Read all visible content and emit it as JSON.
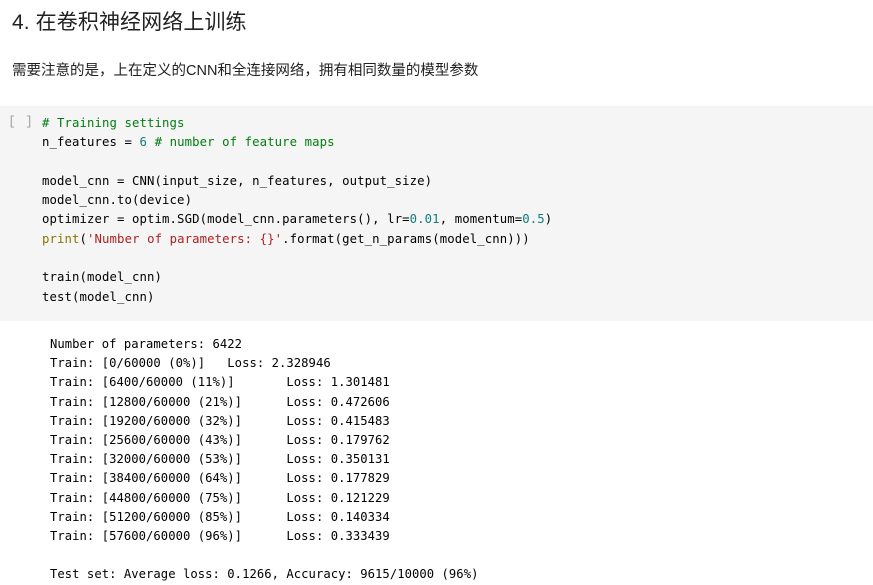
{
  "notebook": {
    "heading": "4. 在卷积神经网络上训练",
    "subtitle": "需要注意的是，上在定义的CNN和全连接网络，拥有相同数量的模型参数",
    "cell": {
      "run_marker": "[ ]",
      "code_lines": [
        [
          {
            "t": "comment",
            "s": "# Training settings"
          }
        ],
        [
          {
            "t": "plain",
            "s": "n_features = "
          },
          {
            "t": "number",
            "s": "6"
          },
          {
            "t": "plain",
            "s": " "
          },
          {
            "t": "comment",
            "s": "# number of feature maps"
          }
        ],
        [
          {
            "t": "plain",
            "s": ""
          }
        ],
        [
          {
            "t": "plain",
            "s": "model_cnn = CNN(input_size, n_features, output_size)"
          }
        ],
        [
          {
            "t": "plain",
            "s": "model_cnn.to(device)"
          }
        ],
        [
          {
            "t": "plain",
            "s": "optimizer = optim.SGD(model_cnn.parameters(), lr="
          },
          {
            "t": "number",
            "s": "0.01"
          },
          {
            "t": "plain",
            "s": ", momentum="
          },
          {
            "t": "number",
            "s": "0.5"
          },
          {
            "t": "plain",
            "s": ")"
          }
        ],
        [
          {
            "t": "builtin",
            "s": "print"
          },
          {
            "t": "plain",
            "s": "("
          },
          {
            "t": "string",
            "s": "'Number of parameters: {}'"
          },
          {
            "t": "plain",
            "s": ".format(get_n_params(model_cnn)))"
          }
        ],
        [
          {
            "t": "plain",
            "s": ""
          }
        ],
        [
          {
            "t": "plain",
            "s": "train(model_cnn)"
          }
        ],
        [
          {
            "t": "plain",
            "s": "test(model_cnn)"
          }
        ]
      ],
      "output_lines": [
        "Number of parameters: 6422",
        "Train: [0/60000 (0%)]\tLoss: 2.328946",
        "Train: [6400/60000 (11%)]\tLoss: 1.301481",
        "Train: [12800/60000 (21%)]\tLoss: 0.472606",
        "Train: [19200/60000 (32%)]\tLoss: 0.415483",
        "Train: [25600/60000 (43%)]\tLoss: 0.179762",
        "Train: [32000/60000 (53%)]\tLoss: 0.350131",
        "Train: [38400/60000 (64%)]\tLoss: 0.177829",
        "Train: [44800/60000 (75%)]\tLoss: 0.121229",
        "Train: [51200/60000 (85%)]\tLoss: 0.140334",
        "Train: [57600/60000 (96%)]\tLoss: 0.333439",
        "",
        "Test set: Average loss: 0.1266, Accuracy: 9615/10000 (96%)"
      ]
    },
    "colors": {
      "cell_background": "#f5f5f5",
      "page_background": "#ffffff",
      "comment": "#007f0e",
      "number": "#0f7d7d",
      "builtin": "#8a7500",
      "string": "#b02020",
      "text": "#000000",
      "run_marker": "#9aa0a6"
    }
  }
}
